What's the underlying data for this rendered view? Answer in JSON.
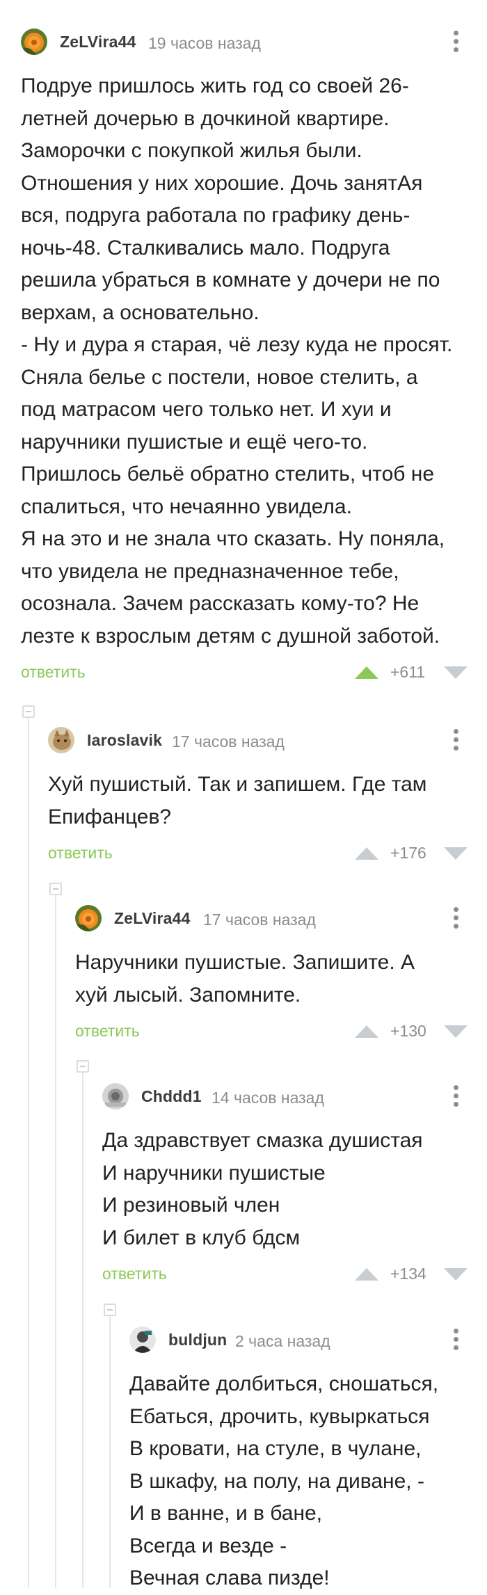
{
  "comments": [
    {
      "username": "ZeLVira44",
      "time": "19 часов назад",
      "avatar_icon": "orange-flower-avatar",
      "lines": [
        "Подруе пришлось жить год со своей 26-",
        "летней дочерью в дочкиной квартире.",
        "Заморочки с покупкой жилья были.",
        "Отношения у них хорошие. Дочь занятАя",
        "вся, подруга работала по графику день-",
        "ночь-48. Сталкивались мало. Подруга",
        "решила убраться в комнате у дочери не по",
        "верхам, а основательно.",
        "- Ну и дура я старая, чё лезу куда не просят.",
        "Сняла белье с постели, новое стелить, а",
        "под матрасом чего только нет. И хуи и",
        "наручники пушистые и ещё чего-то.",
        "Пришлось бельё обратно стелить, чтоб не",
        "спалиться, что нечаянно увидела.",
        "Я на это и не знала что сказать. Ну поняла,",
        "что увидела не предназначенное тебе,",
        "осознала. Зачем рассказать кому-то? Не",
        "лезте к взрослым детям с душной заботой."
      ],
      "reply_label": "ответить",
      "rating": "+611",
      "upvoted": true
    },
    {
      "username": "Iaroslavik",
      "time": "17 часов назад",
      "avatar_icon": "cat-photo-avatar",
      "lines": [
        "Хуй пушистый. Так и запишем. Где там",
        "Епифанцев?"
      ],
      "reply_label": "ответить",
      "rating": "+176",
      "upvoted": false
    },
    {
      "username": "ZeLVira44",
      "time": "17 часов назад",
      "avatar_icon": "orange-flower-avatar",
      "lines": [
        "Наручники пушистые. Запишите. А",
        "хуй лысый. Запомните."
      ],
      "reply_label": "ответить",
      "rating": "+130",
      "upvoted": false
    },
    {
      "username": "Chddd1",
      "time": "14 часов назад",
      "avatar_icon": "grey-photo-avatar",
      "lines": [
        "Да здравствует смазка душистая",
        "И наручники пушистые",
        "И резиновый член",
        "И билет в клуб бдсм"
      ],
      "reply_label": "ответить",
      "rating": "+134",
      "upvoted": false
    },
    {
      "username": "buldjun",
      "time": "2 часа назад",
      "avatar_icon": "dark-photo-avatar",
      "lines": [
        "Давайте долбиться, сношаться,",
        "Ебаться, дрочить, кувыркаться",
        "В кровати, на стуле, в чулане,",
        "В шкафу, на полу, на диване, -",
        "И в ванне, и в бане,",
        "Всегда и везде -",
        "Вечная слава пизде!"
      ]
    }
  ],
  "colors": {
    "accent_green": "#8ac858",
    "muted_grey": "#8c8c8c",
    "vote_inactive": "#c8cdd2"
  }
}
